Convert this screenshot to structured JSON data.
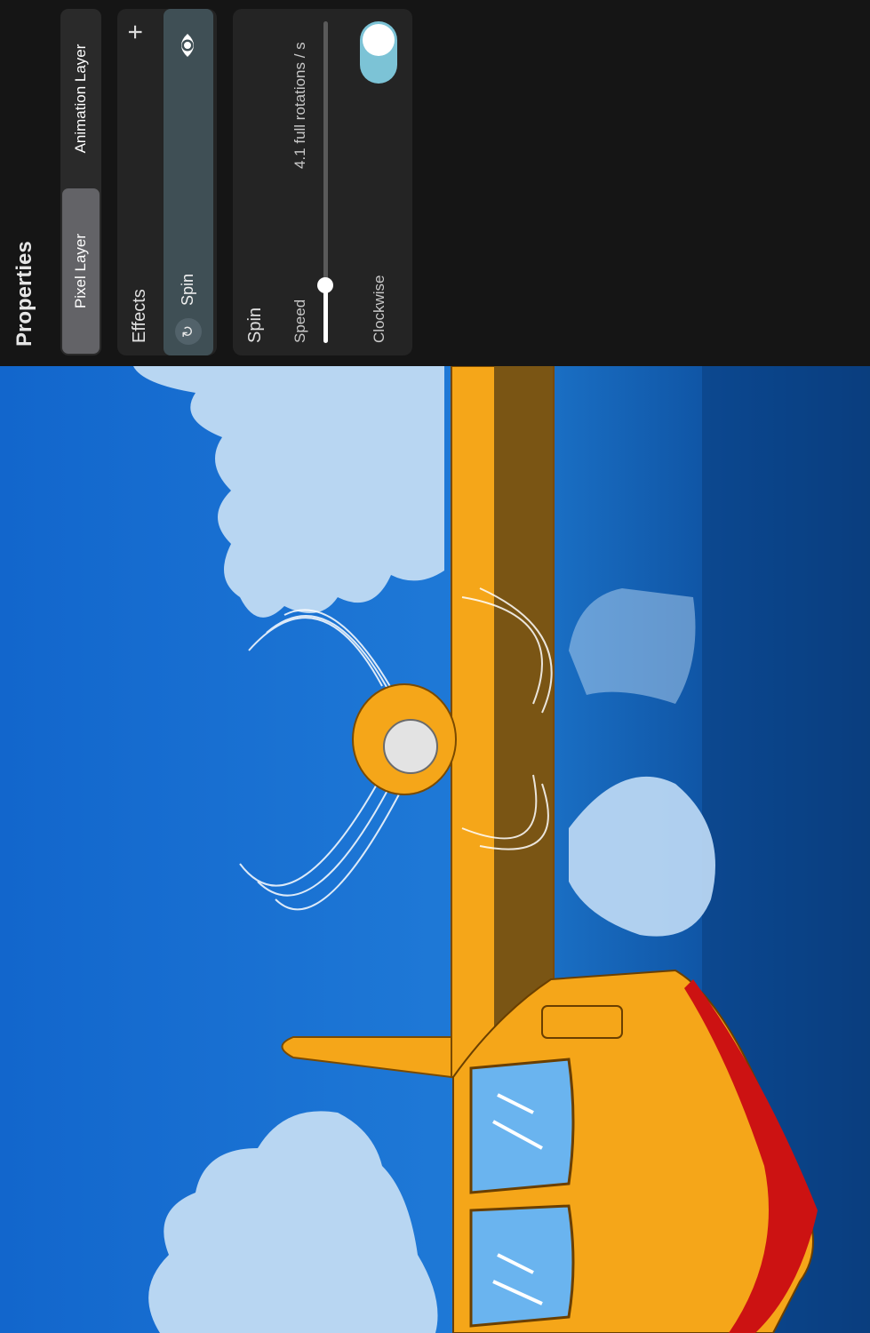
{
  "panel": {
    "title": "Properties",
    "layer_tabs": [
      {
        "label": "Pixel Layer",
        "selected": true
      },
      {
        "label": "Animation Layer",
        "selected": false
      }
    ]
  },
  "effects": {
    "title": "Effects",
    "add_icon": "plus-icon",
    "items": [
      {
        "label": "Spin",
        "icon": "spin-icon",
        "visible": true
      }
    ]
  },
  "spin": {
    "title": "Spin",
    "speed_label": "Speed",
    "speed_value": "4.1 full rotations / s",
    "speed_fraction": 0.18,
    "clockwise_label": "Clockwise",
    "clockwise": true
  },
  "colors": {
    "toggle_on": "#7cc3d6",
    "sky": "#1576d4",
    "sea": "#0b4e9a",
    "plane_yellow": "#f5a619",
    "plane_red": "#cc1212"
  }
}
